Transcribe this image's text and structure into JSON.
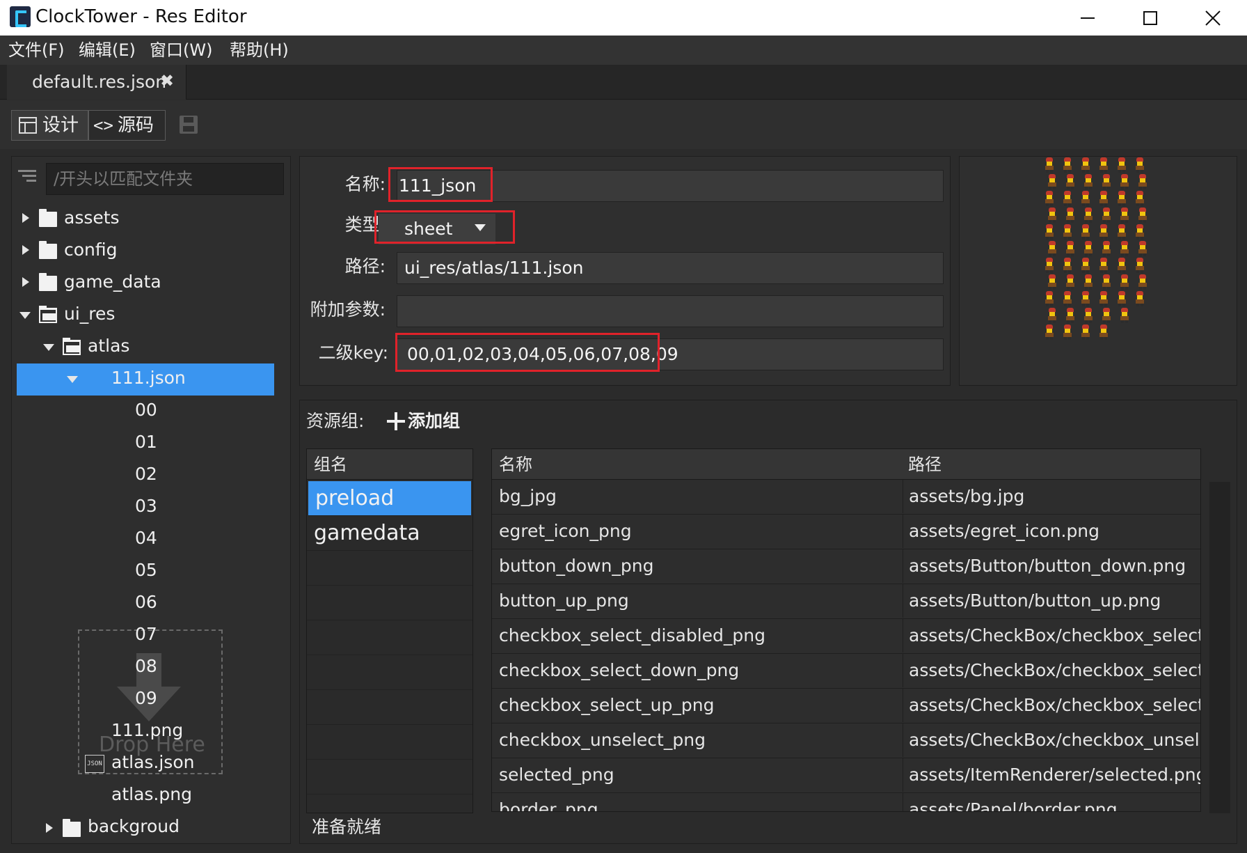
{
  "window": {
    "title": "ClockTower - Res Editor",
    "controls": {
      "minimize": "minimize-icon",
      "maximize": "maximize-icon",
      "close": "close-icon"
    }
  },
  "menu": [
    "文件(F)",
    "编辑(E)",
    "窗口(W)",
    "帮助(H)"
  ],
  "tab": {
    "label": "default.res.json",
    "close_glyph": "✖"
  },
  "toolbar": {
    "design_label": "设计",
    "source_label": "源码",
    "source_glyph": "<>",
    "save_icon": "save-icon"
  },
  "tree": {
    "search_placeholder": "/开头以匹配文件夹",
    "items": [
      {
        "label": "assets",
        "kind": "folder",
        "state": "collapsed"
      },
      {
        "label": "config",
        "kind": "folder",
        "state": "collapsed"
      },
      {
        "label": "game_data",
        "kind": "folder",
        "state": "collapsed"
      },
      {
        "label": "ui_res",
        "kind": "folder",
        "state": "expanded"
      },
      {
        "label": "atlas",
        "kind": "folder",
        "state": "expanded"
      },
      {
        "label": "111.json",
        "kind": "file",
        "state": "expanded",
        "selected": true
      },
      {
        "label": "00"
      },
      {
        "label": "01"
      },
      {
        "label": "02"
      },
      {
        "label": "03"
      },
      {
        "label": "04"
      },
      {
        "label": "05"
      },
      {
        "label": "06"
      },
      {
        "label": "07"
      },
      {
        "label": "08"
      },
      {
        "label": "09"
      },
      {
        "label": "111.png"
      },
      {
        "label": "atlas.json",
        "icon": "json-file-icon"
      },
      {
        "label": "atlas.png"
      },
      {
        "label": "backgroud",
        "kind": "folder",
        "state": "collapsed"
      }
    ],
    "drop_text": "Drop Here"
  },
  "properties": {
    "name_label": "名称:",
    "name_value": "111_json",
    "type_label": "类型:",
    "type_value": "sheet",
    "path_label": "路径:",
    "path_value": "ui_res/atlas/111.json",
    "extra_label": "附加参数:",
    "extra_value": "",
    "subkey_label": "二级key:",
    "subkey_value": "00,01,02,03,04,05,06,07,08,09",
    "highlight_color": "#e0222a"
  },
  "groups": {
    "section_label": "资源组:",
    "add_label": "添加组",
    "header": "组名",
    "items": [
      "preload",
      "gamedata"
    ],
    "selected": "preload"
  },
  "resources": {
    "headers": {
      "name": "名称",
      "path": "路径"
    },
    "rows": [
      {
        "name": "bg_jpg",
        "path": "assets/bg.jpg"
      },
      {
        "name": "egret_icon_png",
        "path": "assets/egret_icon.png"
      },
      {
        "name": "button_down_png",
        "path": "assets/Button/button_down.png"
      },
      {
        "name": "button_up_png",
        "path": "assets/Button/button_up.png"
      },
      {
        "name": "checkbox_select_disabled_png",
        "path": "assets/CheckBox/checkbox_select_di"
      },
      {
        "name": "checkbox_select_down_png",
        "path": "assets/CheckBox/checkbox_select_d"
      },
      {
        "name": "checkbox_select_up_png",
        "path": "assets/CheckBox/checkbox_select_u"
      },
      {
        "name": "checkbox_unselect_png",
        "path": "assets/CheckBox/checkbox_unselect"
      },
      {
        "name": "selected_png",
        "path": "assets/ItemRenderer/selected.png"
      },
      {
        "name": "border_png",
        "path": "assets/Panel/border.png"
      }
    ]
  },
  "status": "准备就绪",
  "colors": {
    "selection": "#3a95f0",
    "background": "#2b2b2b",
    "menu": "#333333"
  }
}
